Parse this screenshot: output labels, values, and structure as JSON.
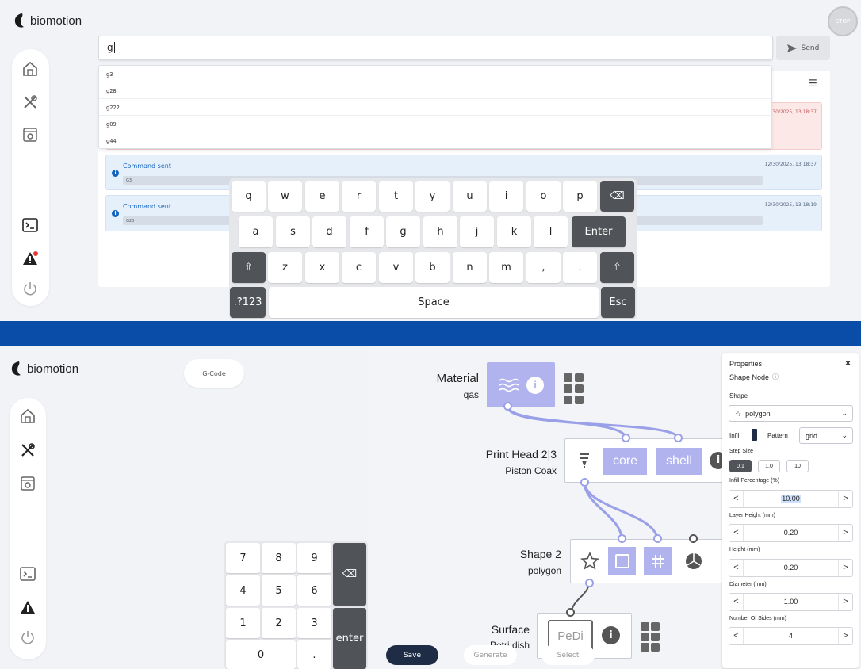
{
  "brand": {
    "name": "biomotion"
  },
  "top": {
    "stop_label": "STOP",
    "command_input": {
      "value": "g"
    },
    "send_label": "Send",
    "suggestions": [
      "g3",
      "g28",
      "g222",
      "g09",
      "g44"
    ],
    "menu_icon": "hamburger-icon",
    "log_entries": [
      {
        "title": "",
        "time": "12/30/2025, 13:18:37",
        "code": "",
        "status": "error"
      },
      {
        "title": "Command sent",
        "time": "12/30/2025, 13:18:37",
        "code": "G3",
        "status": "info"
      },
      {
        "title": "Command sent",
        "time": "12/30/2025, 13:18:19",
        "code": "G28",
        "status": "info"
      }
    ],
    "keyboard": {
      "row1": [
        "q",
        "w",
        "e",
        "r",
        "t",
        "y",
        "u",
        "i",
        "o",
        "p"
      ],
      "backspace": "⌫",
      "row2": [
        "a",
        "s",
        "d",
        "f",
        "g",
        "h",
        "j",
        "k",
        "l"
      ],
      "enter": "Enter",
      "shift": "⇧",
      "row3": [
        "z",
        "x",
        "c",
        "v",
        "b",
        "n",
        "m",
        ",",
        "."
      ],
      "mode": ".?123",
      "space": "Space",
      "esc": "Esc"
    }
  },
  "bottom": {
    "gcode_label": "G-Code",
    "numpad": {
      "keys": [
        "7",
        "8",
        "9",
        "4",
        "5",
        "6",
        "1",
        "2",
        "3"
      ],
      "zero": "0",
      "dot": ".",
      "backspace": "⌫",
      "enter": "enter"
    },
    "nodes": {
      "material": {
        "title": "Material",
        "subtitle": "qas"
      },
      "printhead": {
        "title": "Print Head 2|3",
        "subtitle": "Piston Coax",
        "core": "core",
        "shell": "shell"
      },
      "shape": {
        "title": "Shape 2",
        "subtitle": "polygon"
      },
      "surface": {
        "title": "Surface",
        "subtitle": "Petri dish",
        "chip": "PeDi"
      }
    },
    "actions": {
      "save": "Save",
      "generate": "Generate",
      "select": "Select"
    },
    "properties": {
      "title": "Properties",
      "close": "×",
      "subtitle": "Shape Node",
      "shape_label": "Shape",
      "shape_value": "polygon",
      "infill_label": "Infill",
      "pattern_label": "Pattern",
      "pattern_value": "grid",
      "step_label": "Step Size",
      "steps": [
        "0.1",
        "1.0",
        "10"
      ],
      "infill_pct_label": "Infill Percentage (%)",
      "infill_pct": "10.00",
      "layer_height_label": "Layer Height (mm)",
      "layer_height": "0.20",
      "height_label": "Height (mm)",
      "height": "0.20",
      "diameter_label": "Diameter (mm)",
      "diameter": "1.00",
      "sides_label": "Number Of Sides (mm)",
      "sides": "4"
    }
  },
  "colors": {
    "accent": "#0a4da8",
    "node_chip": "#b0b3ee",
    "log_info": "#e6f0fb",
    "log_error": "#fde8e8",
    "dark_key": "#505358"
  }
}
